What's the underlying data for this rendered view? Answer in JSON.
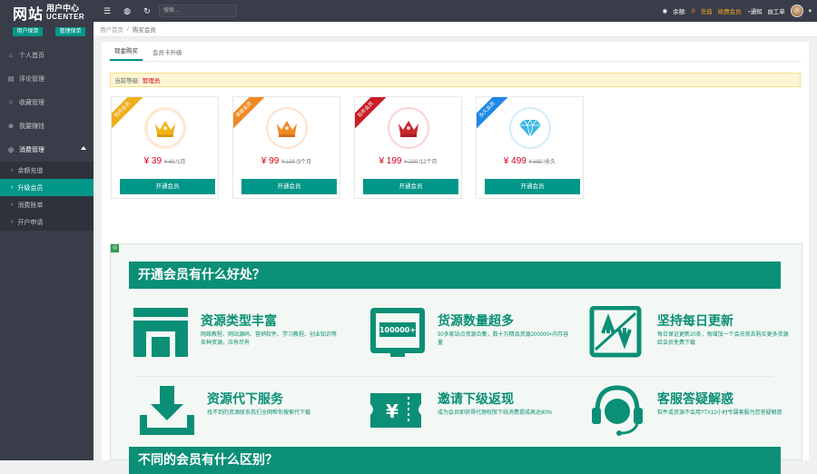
{
  "logo": {
    "big": "网站",
    "small_top": "用户中心",
    "small_bottom": "UCENTER",
    "btn1": "用户保单",
    "btn2": "管理保单"
  },
  "sidebar": {
    "items": [
      {
        "label": "个人首页",
        "icon": "home-icon"
      },
      {
        "label": "评论管理",
        "icon": "comment-icon"
      },
      {
        "label": "收藏管理",
        "icon": "star-icon"
      },
      {
        "label": "我要赚钱",
        "icon": "money-icon"
      },
      {
        "label": "消费管理",
        "icon": "cart-icon"
      }
    ],
    "sub_items": [
      "余额充值",
      "升级会员",
      "消费账单",
      "开户申请"
    ]
  },
  "topbar": {
    "search_placeholder": "搜索...",
    "balance_label": "余额:",
    "balance_value": "0",
    "recharge": "充值",
    "renew": "续费会员",
    "notify": "通知",
    "ticket": "工单"
  },
  "breadcrumb": {
    "home": "用户首页",
    "current": "购买会员"
  },
  "tabs": [
    "现金购买",
    "会员卡升级"
  ],
  "level": {
    "label": "当前等级:",
    "value": "管理员"
  },
  "cards": [
    {
      "ribbon": "包月会员",
      "ribbon_color": "#f0ad1b",
      "icon_color": "#f0b416",
      "ring_color": "#fdebd0",
      "price": "¥ 39",
      "orig": "¥ 69",
      "unit": "/1月",
      "btn": "开通会员"
    },
    {
      "ribbon": "季度会员",
      "ribbon_color": "#f08a24",
      "icon_color": "#f08a24",
      "ring_color": "#fde2cc",
      "price": "¥ 99",
      "orig": "¥ 199",
      "unit": "/3个月",
      "btn": "开通会员"
    },
    {
      "ribbon": "包年会员",
      "ribbon_color": "#c81d25",
      "icon_color": "#c9272e",
      "ring_color": "#f8d3d3",
      "price": "¥ 199",
      "orig": "¥ 299",
      "unit": "/12个月",
      "btn": "开通会员"
    },
    {
      "ribbon": "永久会员",
      "ribbon_color": "#1e88e5",
      "icon_color": "#3ab6e6",
      "ring_color": "#d3ecf8",
      "price": "¥ 499",
      "orig": "¥ 899",
      "unit": "/永久",
      "btn": "开通会员"
    }
  ],
  "promo": {
    "banner1": "开通会员有什么好处？",
    "banner2": "不同的会员有什么区别？",
    "features": [
      {
        "title": "资源类型丰富",
        "desc": "网络教程、网站源码、营销软件、学习教程、创业知识等各种资源，应有尽有",
        "icon": "folder-icon"
      },
      {
        "title": "货源数量超多",
        "desc": "50多家站点资源合集，数十万精品资源200000+内存容量",
        "icon": "monitor-icon",
        "badge": "100000+"
      },
      {
        "title": "坚持每日更新",
        "desc": "每日保证更新20条，每增加一个会员就去购买更多资源给会员免费下载",
        "icon": "update-icon"
      },
      {
        "title": "资源代下服务",
        "desc": "找不到的资源联系我们全网帮你搜索代下载",
        "icon": "download-icon"
      },
      {
        "title": "邀请下级返现",
        "desc": "成为会员即获得代理权限下线消费提成高达80%",
        "icon": "ticket-icon",
        "badge": "¥"
      },
      {
        "title": "客服答疑解惑",
        "desc": "软件或资源不会用?TX12小时专属客服为您答疑解惑",
        "icon": "headset-icon"
      }
    ]
  }
}
